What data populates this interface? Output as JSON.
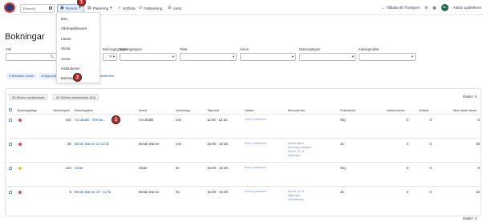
{
  "topbar": {
    "search_placeholder": "[Search]",
    "nav": [
      {
        "label": "Resurs",
        "icon": "resource-icon"
      },
      {
        "label": "Planering",
        "icon": "planning-icon"
      },
      {
        "label": "Körlista",
        "icon": "roster-icon"
      },
      {
        "label": "Fakturering",
        "icon": "invoice-icon"
      },
      {
        "label": "Listor",
        "icon": "list-icon"
      }
    ],
    "back_link": "Tillbaka till Thorbjörn",
    "user_initials": "AL",
    "user_name": "Astrid Lydelshorn"
  },
  "dropdown": {
    "items": [
      "Elev",
      "Vårdnadshavare",
      "Lärare",
      "Skola",
      "Arena",
      "Institutionen",
      "Bokning"
    ]
  },
  "page": {
    "title": "Bokningar"
  },
  "filters": [
    {
      "label": "Sök",
      "value": ""
    },
    {
      "label": "Bokningsgrupper",
      "value": ""
    },
    {
      "label": "Bokningsägare",
      "value": ""
    },
    {
      "label": "Plats",
      "value": ""
    },
    {
      "label": "Ämne",
      "value": ""
    },
    {
      "label": "Bokningstyper",
      "value": ""
    },
    {
      "label": "Katalogmallar",
      "value": ""
    }
  ],
  "pills": [
    "Fullbokade kurser",
    "Lediga platser"
  ],
  "filter_link": "Nollställ filter",
  "tabs": [
    "53 Skicka meddelande",
    "00 Skicka meddelande (Kö)"
  ],
  "rows_label": "Rader: 4",
  "table": {
    "headers": [
      "Bokningsläge",
      "Bokningsid",
      "Bokningstitel",
      "Ämne",
      "Veckodag",
      "Tidpunkt",
      "Lärare",
      "Elevnärvaro",
      "Publicerad",
      "Aktiva elever",
      "Kölista",
      "Max antal elever"
    ],
    "rows": [
      {
        "status_color": "#e05050",
        "id": "161",
        "title": "Acrobatik - Termin...",
        "subject": "Acrobatik",
        "day": "ons",
        "time": "11:00 - 12:15",
        "teacher": "Anna Lydelshorn",
        "students": [],
        "published": "Nej",
        "active": "0",
        "queue": "0",
        "max": "0"
      },
      {
        "status_color": "#e05050",
        "id": "30",
        "title": "Break Dance 12-14 år",
        "subject": "Break Dance",
        "day": "ons",
        "time": "15:00 - 15:30",
        "teacher": "Anna Lydelshorn",
        "students": [
          "Aktiva flickor",
          "Kvinnliga dansare",
          "Elever 12-14",
          "Nybörjare"
        ],
        "published": "Ja",
        "active": "3",
        "queue": "0",
        "max": "30"
      },
      {
        "status_color": "#e8c930",
        "id": "124",
        "title": "Gitarr",
        "subject": "Gitarr",
        "day": "tis",
        "time": "15:00 - 15:30",
        "teacher": "Anna Lydelshorn",
        "students": [],
        "published": "Nej",
        "active": "0",
        "queue": "0",
        "max": "0"
      },
      {
        "status_color": "#e05050",
        "id": "5",
        "title": "Break Dance 10 - 12 år",
        "subject": "Break Dance",
        "day": "fre",
        "time": "15:00 - 15:30",
        "teacher": "Anna Lydelshorn",
        "students": [
          "Elever 10-12",
          "Nybörjare",
          "Fortsättning"
        ],
        "published": "Ja",
        "active": "3",
        "queue": "0",
        "max": "12"
      }
    ]
  },
  "footer_rows": "Rader: 4",
  "markers": [
    "1",
    "2",
    "3"
  ]
}
